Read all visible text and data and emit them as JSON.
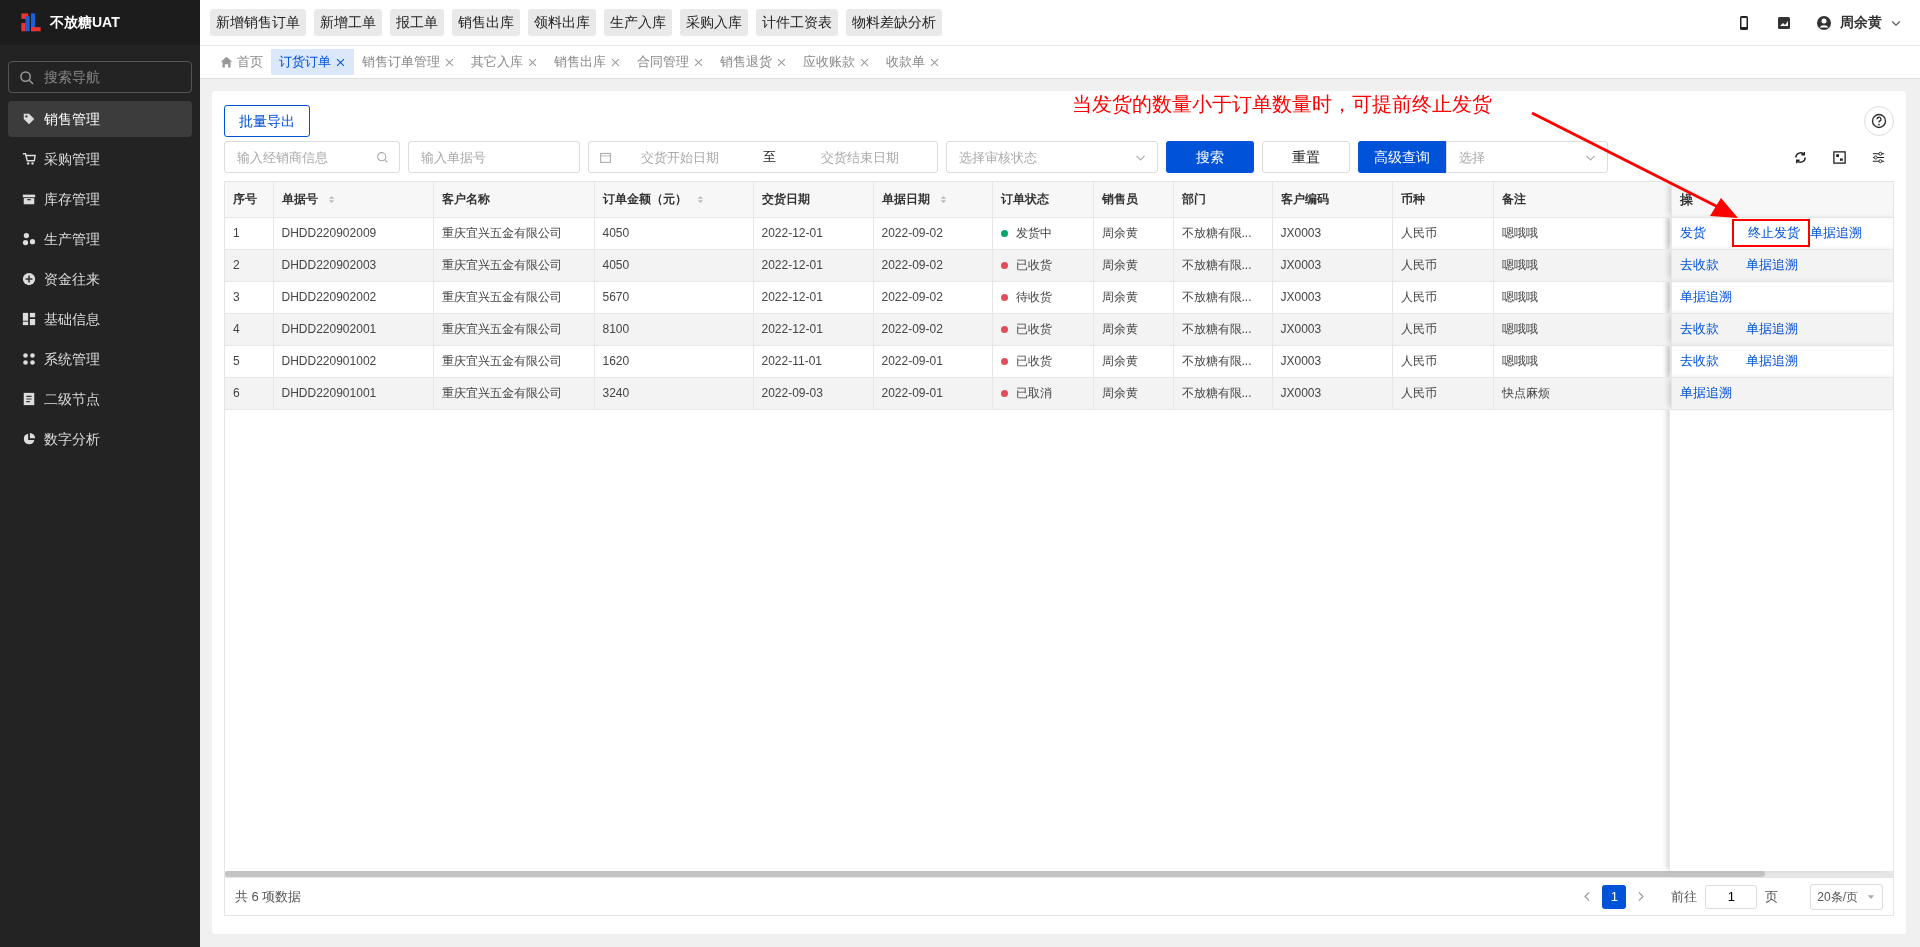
{
  "app": {
    "title": "不放糖UAT"
  },
  "sidebar": {
    "search_placeholder": "搜索导航",
    "items": [
      {
        "label": "销售管理",
        "selected": true
      },
      {
        "label": "采购管理",
        "selected": false
      },
      {
        "label": "库存管理",
        "selected": false
      },
      {
        "label": "生产管理",
        "selected": false
      },
      {
        "label": "资金往来",
        "selected": false
      },
      {
        "label": "基础信息",
        "selected": false
      },
      {
        "label": "系统管理",
        "selected": false
      },
      {
        "label": "二级节点",
        "selected": false
      },
      {
        "label": "数字分析",
        "selected": false
      }
    ]
  },
  "quick_buttons": [
    "新增销售订单",
    "新增工单",
    "报工单",
    "销售出库",
    "领料出库",
    "生产入库",
    "采购入库",
    "计件工资表",
    "物料差缺分析"
  ],
  "user": {
    "name": "周余黄"
  },
  "tabs": [
    {
      "label": "首页",
      "kind": "home",
      "selected": false
    },
    {
      "label": "订货订单",
      "kind": "closable",
      "selected": true
    },
    {
      "label": "销售订单管理",
      "kind": "closable",
      "selected": false
    },
    {
      "label": "其它入库",
      "kind": "closable",
      "selected": false
    },
    {
      "label": "销售出库",
      "kind": "closable",
      "selected": false
    },
    {
      "label": "合同管理",
      "kind": "closable",
      "selected": false
    },
    {
      "label": "销售退货",
      "kind": "closable",
      "selected": false
    },
    {
      "label": "应收账款",
      "kind": "closable",
      "selected": false
    },
    {
      "label": "收款单",
      "kind": "closable",
      "selected": false
    }
  ],
  "export_button": "批量导出",
  "annotation": {
    "text": "当发货的数量小于订单数量时，可提前终止发货"
  },
  "filters": {
    "dealer_placeholder": "输入经销商信息",
    "number_placeholder": "输入单据号",
    "date_start_placeholder": "交货开始日期",
    "date_separator": "至",
    "date_end_placeholder": "交货结束日期",
    "status_placeholder": "选择审核状态",
    "search_button": "搜索",
    "reset_button": "重置",
    "advanced_button": "高级查询",
    "advanced_placeholder": "选择"
  },
  "table": {
    "columns": [
      {
        "label": "序号",
        "sortable": false
      },
      {
        "label": "单据号",
        "sortable": true
      },
      {
        "label": "客户名称",
        "sortable": false
      },
      {
        "label": "订单金额（元）",
        "sortable": true
      },
      {
        "label": "交货日期",
        "sortable": false
      },
      {
        "label": "单据日期",
        "sortable": true
      },
      {
        "label": "订单状态",
        "sortable": false
      },
      {
        "label": "销售员",
        "sortable": false
      },
      {
        "label": "部门",
        "sortable": false
      },
      {
        "label": "客户编码",
        "sortable": false
      },
      {
        "label": "币种",
        "sortable": false
      },
      {
        "label": "备注",
        "sortable": false
      },
      {
        "label": "操",
        "sortable": false
      }
    ],
    "rows": [
      {
        "cells": [
          "1",
          "DHDD220902009",
          "重庆宜兴五金有限公司",
          "4050",
          "2022-12-01",
          "2022-09-02"
        ],
        "status": {
          "text": "发货中",
          "color": "#00a870"
        },
        "more": [
          "周余黄",
          "不放糖有限...",
          "JX0003",
          "人民币",
          "嗯哦哦"
        ],
        "actions": [
          {
            "label": "发货",
            "boxed": false
          },
          {
            "label": "终止发货",
            "boxed": true
          },
          {
            "label": "单据追溯",
            "boxed": false
          }
        ]
      },
      {
        "cells": [
          "2",
          "DHDD220902003",
          "重庆宜兴五金有限公司",
          "4050",
          "2022-12-01",
          "2022-09-02"
        ],
        "status": {
          "text": "已收货",
          "color": "#e34d59"
        },
        "more": [
          "周余黄",
          "不放糖有限...",
          "JX0003",
          "人民币",
          "嗯哦哦"
        ],
        "actions": [
          {
            "label": "去收款",
            "boxed": false
          },
          {
            "label": "单据追溯",
            "boxed": false
          }
        ]
      },
      {
        "cells": [
          "3",
          "DHDD220902002",
          "重庆宜兴五金有限公司",
          "5670",
          "2022-12-01",
          "2022-09-02"
        ],
        "status": {
          "text": "待收货",
          "color": "#e34d59"
        },
        "more": [
          "周余黄",
          "不放糖有限...",
          "JX0003",
          "人民币",
          "嗯哦哦"
        ],
        "actions": [
          {
            "label": "单据追溯",
            "boxed": false
          }
        ]
      },
      {
        "cells": [
          "4",
          "DHDD220902001",
          "重庆宜兴五金有限公司",
          "8100",
          "2022-12-01",
          "2022-09-02"
        ],
        "status": {
          "text": "已收货",
          "color": "#e34d59"
        },
        "more": [
          "周余黄",
          "不放糖有限...",
          "JX0003",
          "人民币",
          "嗯哦哦"
        ],
        "actions": [
          {
            "label": "去收款",
            "boxed": false
          },
          {
            "label": "单据追溯",
            "boxed": false
          }
        ]
      },
      {
        "cells": [
          "5",
          "DHDD220901002",
          "重庆宜兴五金有限公司",
          "1620",
          "2022-11-01",
          "2022-09-01"
        ],
        "status": {
          "text": "已收货",
          "color": "#e34d59"
        },
        "more": [
          "周余黄",
          "不放糖有限...",
          "JX0003",
          "人民币",
          "嗯哦哦"
        ],
        "actions": [
          {
            "label": "去收款",
            "boxed": false
          },
          {
            "label": "单据追溯",
            "boxed": false
          }
        ]
      },
      {
        "cells": [
          "6",
          "DHDD220901001",
          "重庆宜兴五金有限公司",
          "3240",
          "2022-09-03",
          "2022-09-01"
        ],
        "status": {
          "text": "已取消",
          "color": "#e34d59"
        },
        "more": [
          "周余黄",
          "不放糖有限...",
          "JX0003",
          "人民币",
          "快点麻烦"
        ],
        "actions": [
          {
            "label": "单据追溯",
            "boxed": false
          }
        ]
      }
    ]
  },
  "footer": {
    "total": "共 6 项数据",
    "pages": [
      {
        "label": "1",
        "selected": true
      }
    ],
    "goto_label": "前往",
    "goto_value": "1",
    "page_unit": "页",
    "page_size": "20条/页"
  }
}
